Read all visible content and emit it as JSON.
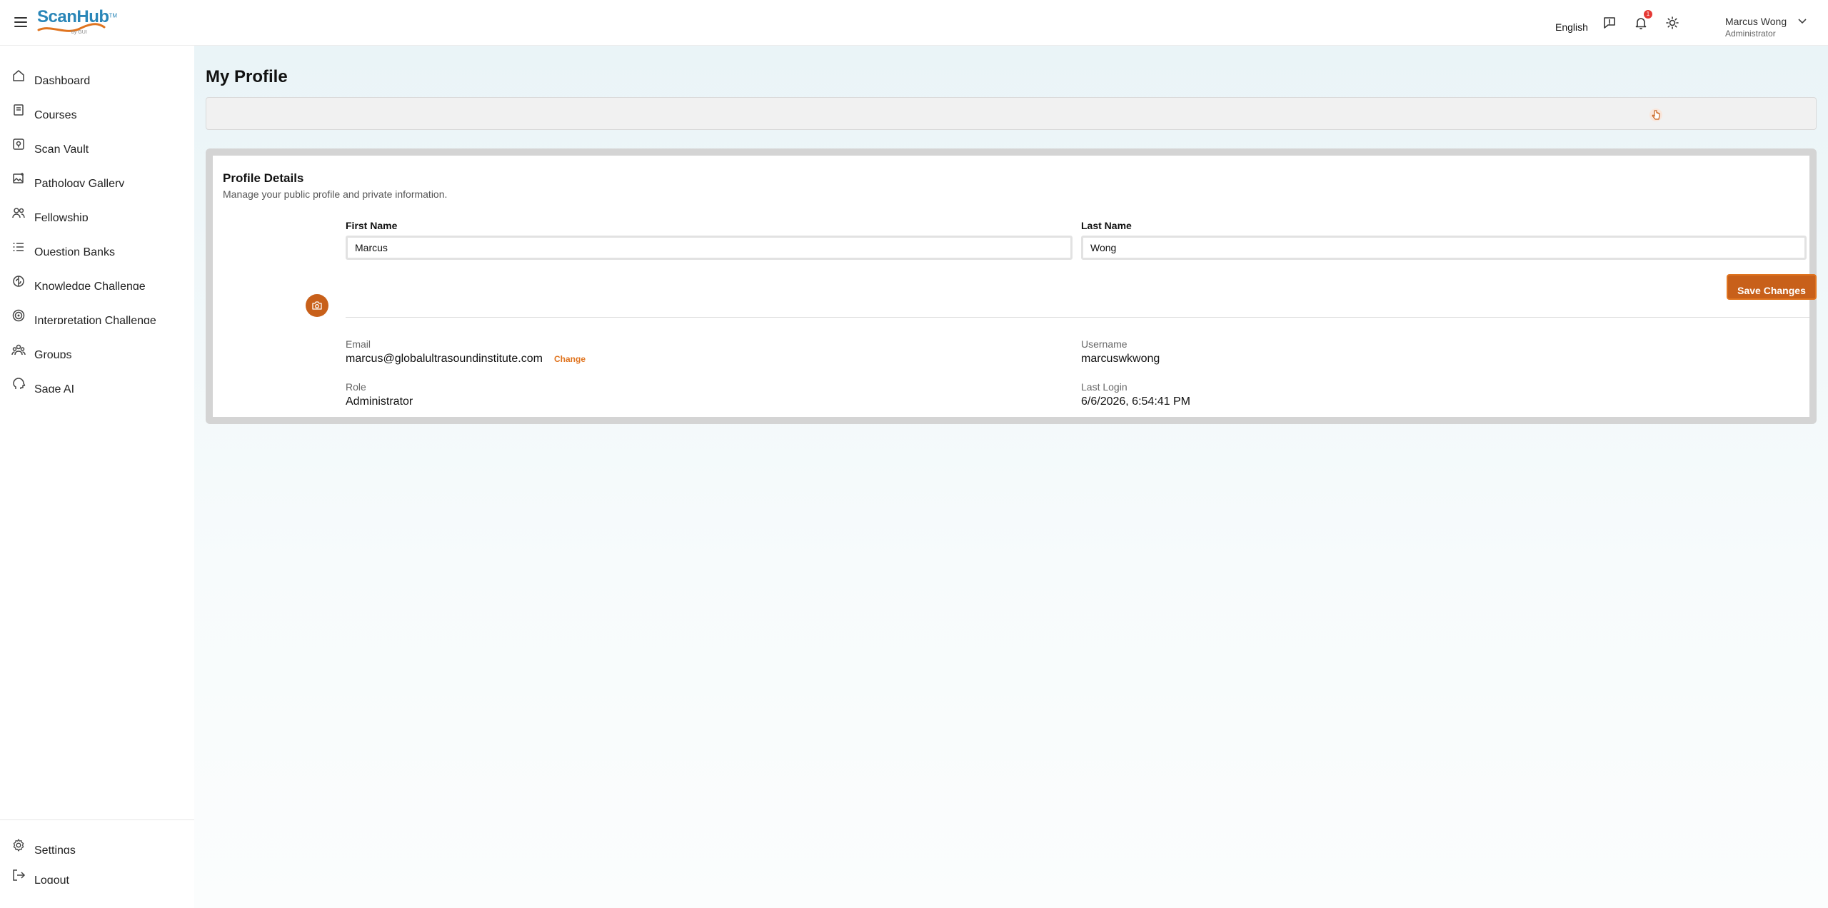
{
  "header": {
    "logo_text": "ScanHub",
    "logo_tm": "TM",
    "logo_sub": "by GUI",
    "language": "English",
    "notification_count": "1",
    "user_name": "Marcus Wong",
    "user_role": "Administrator"
  },
  "sidebar": {
    "items": [
      {
        "label": "Dashboard",
        "icon": "home-icon"
      },
      {
        "label": "Courses",
        "icon": "book-icon"
      },
      {
        "label": "Scan Vault",
        "icon": "vault-icon"
      },
      {
        "label": "Pathology Gallery",
        "icon": "gallery-icon"
      },
      {
        "label": "Fellowship",
        "icon": "people-icon"
      },
      {
        "label": "Question Banks",
        "icon": "list-icon"
      },
      {
        "label": "Knowledge Challenge",
        "icon": "brain-icon"
      },
      {
        "label": "Interpretation Challenge",
        "icon": "target-icon"
      },
      {
        "label": "Groups",
        "icon": "group-icon"
      },
      {
        "label": "Sage AI",
        "icon": "ai-head-icon"
      }
    ],
    "footer": [
      {
        "label": "Settings",
        "icon": "gear-icon"
      },
      {
        "label": "Logout",
        "icon": "logout-icon"
      }
    ]
  },
  "page": {
    "title": "My Profile"
  },
  "profile": {
    "title": "Profile Details",
    "subtitle": "Manage your public profile and private information.",
    "first_name_label": "First Name",
    "first_name_value": "Marcus",
    "last_name_label": "Last Name",
    "last_name_value": "Wong",
    "save_label": "Save Changes",
    "email_label": "Email",
    "email_value": "marcus@globalultrasoundinstitute.com",
    "change_label": "Change",
    "username_label": "Username",
    "username_value": "marcuswkwong",
    "role_label": "Role",
    "role_value": "Administrator",
    "last_login_label": "Last Login",
    "last_login_value": "6/6/2026, 6:54:41 PM"
  },
  "colors": {
    "accent": "#c8601a",
    "brand": "#2a86b8",
    "badge": "#e53935"
  }
}
